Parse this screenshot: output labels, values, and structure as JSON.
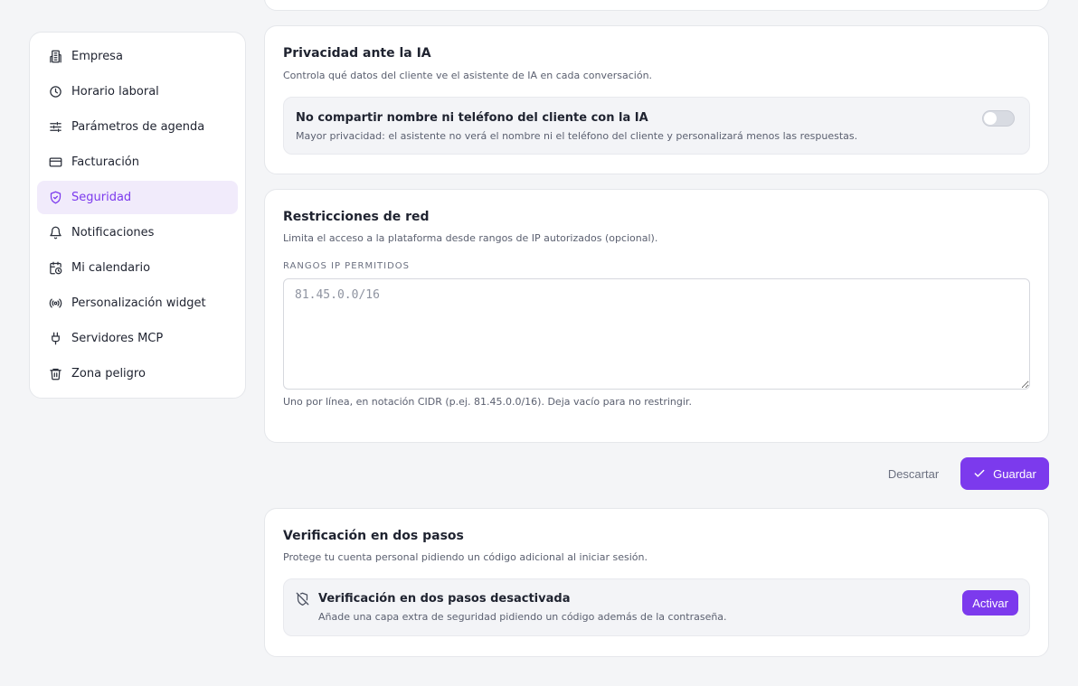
{
  "sidebar": {
    "items": [
      {
        "label": "Empresa",
        "icon": "building-icon"
      },
      {
        "label": "Horario laboral",
        "icon": "clock-icon"
      },
      {
        "label": "Parámetros de agenda",
        "icon": "sliders-icon"
      },
      {
        "label": "Facturación",
        "icon": "credit-card-icon"
      },
      {
        "label": "Seguridad",
        "icon": "shield-check-icon",
        "active": true
      },
      {
        "label": "Notificaciones",
        "icon": "bell-icon"
      },
      {
        "label": "Mi calendario",
        "icon": "calendar-clock-icon"
      },
      {
        "label": "Personalización widget",
        "icon": "broadcast-icon"
      },
      {
        "label": "Servidores MCP",
        "icon": "plug-icon"
      },
      {
        "label": "Zona peligro",
        "icon": "trash-icon"
      }
    ]
  },
  "privacy": {
    "title": "Privacidad ante la IA",
    "description": "Controla qué datos del cliente ve el asistente de IA en cada conversación.",
    "option_title": "No compartir nombre ni teléfono del cliente con la IA",
    "option_sub": "Mayor privacidad: el asistente no verá el nombre ni el teléfono del cliente y personalizará menos las respuestas.",
    "toggle_on": false
  },
  "network": {
    "title": "Restricciones de red",
    "description": "Limita el acceso a la plataforma desde rangos de IP autorizados (opcional).",
    "field_label": "Rangos IP permitidos",
    "placeholder": "81.45.0.0/16",
    "hint": "Uno por línea, en notación CIDR (p.ej. 81.45.0.0/16). Deja vacío para no restringir."
  },
  "actions": {
    "discard_label": "Descartar",
    "save_label": "Guardar"
  },
  "two_factor": {
    "title": "Verificación en dos pasos",
    "description": "Protege tu cuenta personal pidiendo un código adicional al iniciar sesión.",
    "status_title": "Verificación en dos pasos desactivada",
    "status_sub": "Añade una capa extra de seguridad pidiendo un código además de la contraseña.",
    "activate_label": "Activar"
  },
  "colors": {
    "accent": "#7c3aed",
    "active_bg": "#f1ebfb",
    "page_bg": "#f4f5f7"
  }
}
